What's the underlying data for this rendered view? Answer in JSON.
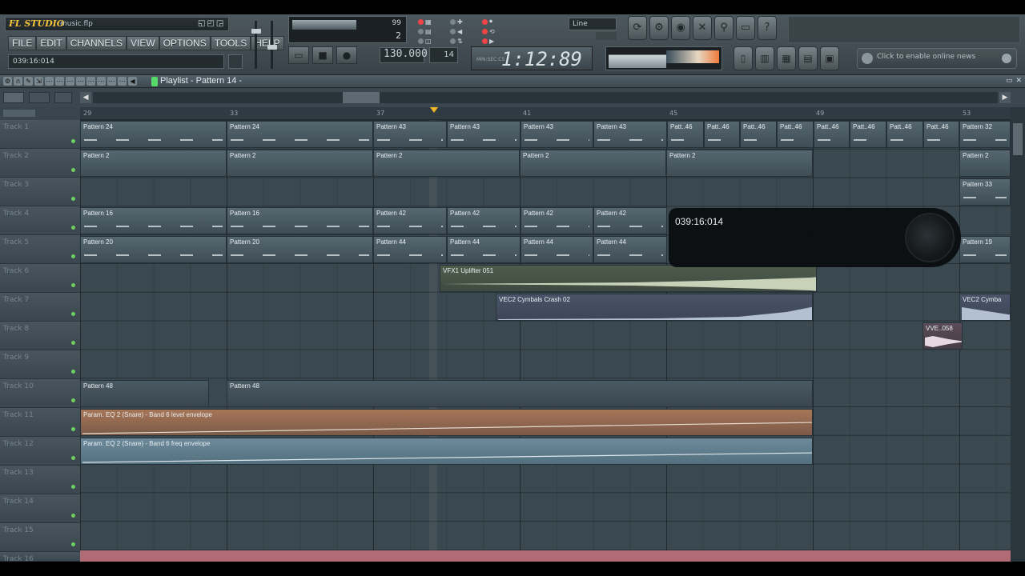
{
  "app": {
    "logo": "FL STUDIO",
    "filename": "music.flp",
    "logo_buttons": "◱◰◲"
  },
  "menu": [
    "FILE",
    "EDIT",
    "CHANNELS",
    "VIEW",
    "OPTIONS",
    "TOOLS",
    "HELP"
  ],
  "hint_bar": "039:16:014",
  "monitor": {
    "num_top": "99",
    "num_mid": "65",
    "num_bottom": "2"
  },
  "transport": {
    "tempo": "130.000",
    "pattern": "14",
    "buttons": [
      "▭",
      "■",
      "●"
    ]
  },
  "pattern_grid": [
    "▦",
    "✚",
    "⏺",
    "▤",
    "◀",
    "⟲",
    "◫",
    "⇅",
    "▶"
  ],
  "snap": {
    "value": "Line"
  },
  "time_display": {
    "value": "1:12:89",
    "label": "MIN:SEC:CS"
  },
  "round_buttons": [
    "⟳",
    "⚙",
    "◉",
    "✕",
    "⚲",
    "▭",
    "?"
  ],
  "round_buttons2": [
    "▯",
    "▥",
    "▦",
    "▤",
    "▣"
  ],
  "news": {
    "text": "Click to enable online news"
  },
  "playlist": {
    "title": "Playlist - Pattern 14 -",
    "window_buttons": [
      "▭",
      "✕"
    ],
    "title_icons": [
      "⚙",
      "∩",
      "✎",
      "⇲",
      "⋯",
      "⋯",
      "⋯",
      "⋯",
      "⋯",
      "⋯",
      "⋯",
      "⋯",
      "◀"
    ]
  },
  "ruler": {
    "ticks": [
      {
        "label": "29"
      },
      {
        "label": "33"
      },
      {
        "label": "37"
      },
      {
        "label": "41"
      },
      {
        "label": "45"
      },
      {
        "label": "49"
      },
      {
        "label": "53"
      }
    ]
  },
  "tracks": [
    "Track 1",
    "Track 2",
    "Track 3",
    "Track 4",
    "Track 5",
    "Track 6",
    "Track 7",
    "Track 8",
    "Track 9",
    "Track 10",
    "Track 11",
    "Track 12",
    "Track 13",
    "Track 14",
    "Track 15",
    "Track 16"
  ],
  "clips": {
    "t1": [
      "Pattern 24",
      "Pattern 24",
      "Pattern 43",
      "Pattern 43",
      "Pattern 43",
      "Pattern 43",
      "Patt..46",
      "Patt..46",
      "Patt..46",
      "Patt..46",
      "Patt..46",
      "Patt..46",
      "Patt..46",
      "Patt..46",
      "Pattern 32"
    ],
    "t2": [
      "Pattern 2",
      "Pattern 2",
      "Pattern 2",
      "Pattern 2",
      "Pattern 2",
      "Pattern 2"
    ],
    "t3": [
      "Pattern 33"
    ],
    "t4": [
      "Pattern 16",
      "Pattern 16",
      "Pattern 42",
      "Pattern 42",
      "Pattern 42",
      "Pattern 42"
    ],
    "t5": [
      "Pattern 20",
      "Pattern 20",
      "Pattern 44",
      "Pattern 44",
      "Pattern 44",
      "Pattern 44",
      "Pattern 19"
    ],
    "t6": "VFX1 Uplifter 051",
    "t7a": "VEC2 Cymbals Crash 02",
    "t7b": "VEC2 Cymba",
    "t8": "VVE..058",
    "t10": [
      "Pattern 48",
      "Pattern 48"
    ],
    "t11": "Param. EQ 2 (Snare) - Band 6 level envelope",
    "t12": "Param. EQ 2 (Snare) - Band 6 freq envelope"
  },
  "hint_overlay": {
    "time": "039:16:014"
  }
}
